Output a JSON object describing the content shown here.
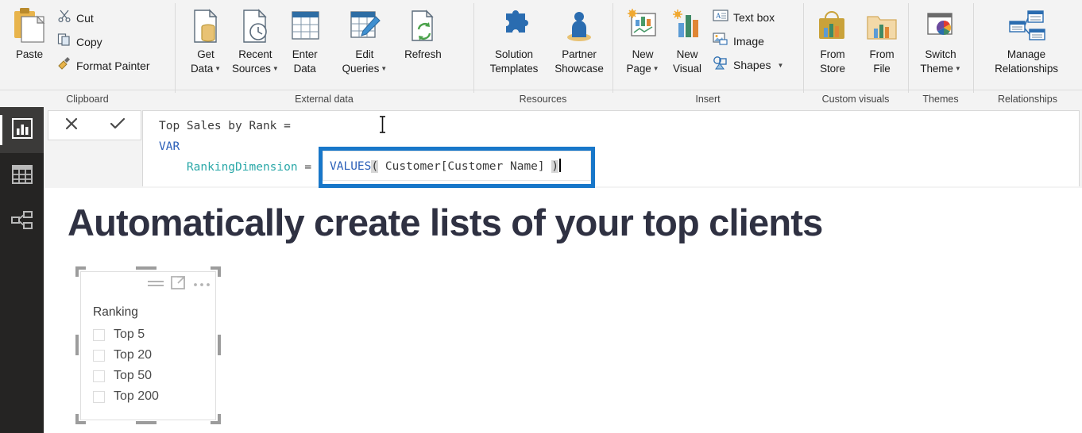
{
  "ribbon": {
    "groups": [
      {
        "name": "clipboard",
        "label": "Clipboard",
        "big_buttons": [
          {
            "label": "Paste",
            "icon": "paste-icon"
          }
        ],
        "small_buttons": [
          {
            "label": "Cut",
            "icon": "cut-icon"
          },
          {
            "label": "Copy",
            "icon": "copy-icon"
          },
          {
            "label": "Format Painter",
            "icon": "format-painter-icon"
          }
        ]
      },
      {
        "name": "external-data",
        "label": "External data",
        "big_buttons": [
          {
            "label": "Get\nData",
            "line1": "Get",
            "line2": "Data",
            "icon": "get-data-icon",
            "caret": true
          },
          {
            "label": "Recent Sources",
            "line1": "Recent",
            "line2": "Sources",
            "icon": "recent-sources-icon",
            "caret": true
          },
          {
            "label": "Enter Data",
            "line1": "Enter",
            "line2": "Data",
            "icon": "enter-data-icon",
            "caret": false
          },
          {
            "label": "Edit Queries",
            "line1": "Edit",
            "line2": "Queries",
            "icon": "edit-queries-icon",
            "caret": true
          },
          {
            "label": "Refresh",
            "line1": "Refresh",
            "line2": "",
            "icon": "refresh-icon",
            "caret": false
          }
        ]
      },
      {
        "name": "resources",
        "label": "Resources",
        "big_buttons": [
          {
            "line1": "Solution",
            "line2": "Templates",
            "icon": "solution-templates-icon",
            "caret": false
          },
          {
            "line1": "Partner",
            "line2": "Showcase",
            "icon": "partner-showcase-icon",
            "caret": false
          }
        ]
      },
      {
        "name": "insert",
        "label": "Insert",
        "big_buttons": [
          {
            "line1": "New",
            "line2": "Page",
            "icon": "new-page-icon",
            "caret": true
          },
          {
            "line1": "New",
            "line2": "Visual",
            "icon": "new-visual-icon",
            "caret": false
          }
        ],
        "small_buttons": [
          {
            "label": "Text box",
            "icon": "text-box-icon",
            "caret": false
          },
          {
            "label": "Image",
            "icon": "image-icon",
            "caret": false
          },
          {
            "label": "Shapes",
            "icon": "shapes-icon",
            "caret": true
          }
        ]
      },
      {
        "name": "custom-visuals",
        "label": "Custom visuals",
        "big_buttons": [
          {
            "line1": "From",
            "line2": "Store",
            "icon": "from-store-icon",
            "caret": false
          },
          {
            "line1": "From",
            "line2": "File",
            "icon": "from-file-icon",
            "caret": false
          }
        ]
      },
      {
        "name": "themes",
        "label": "Themes",
        "big_buttons": [
          {
            "line1": "Switch",
            "line2": "Theme",
            "icon": "switch-theme-icon",
            "caret": true
          }
        ]
      },
      {
        "name": "relationships",
        "label": "Relationships",
        "big_buttons": [
          {
            "line1": "Manage",
            "line2": "Relationships",
            "icon": "manage-relationships-icon",
            "caret": false
          }
        ]
      }
    ]
  },
  "leftnav": {
    "items": [
      {
        "name": "report-view",
        "icon": "bar-chart-icon",
        "active": true
      },
      {
        "name": "data-view",
        "icon": "table-icon",
        "active": false
      },
      {
        "name": "model-view",
        "icon": "relationships-icon",
        "active": false
      }
    ]
  },
  "formula_bar": {
    "cancel_icon": "close-icon",
    "commit_icon": "checkmark-icon",
    "measure_name": "Top Sales by Rank =",
    "keyword_var": "VAR",
    "variable_name": "RankingDimension",
    "assign_op": "=",
    "highlighted_expression": {
      "function": "VALUES",
      "open_paren": "(",
      "argument": " Customer[Customer Name] ",
      "close_paren": ")",
      "border_color": "#1877c9"
    },
    "colors": {
      "keyword": "#2b5fb8",
      "variable": "#2aa8a8",
      "text": "#3b3b3b"
    }
  },
  "canvas": {
    "page_title": "Automatically create lists of your top clients",
    "title_color": "#2f3142",
    "slicer": {
      "header_icons": [
        "filter-lines-icon",
        "focus-mode-icon",
        "more-options-icon"
      ],
      "title": "Ranking",
      "items": [
        {
          "label": "Top 5",
          "checked": false
        },
        {
          "label": "Top 20",
          "checked": false
        },
        {
          "label": "Top 50",
          "checked": false
        },
        {
          "label": "Top 200",
          "checked": false
        }
      ]
    }
  }
}
